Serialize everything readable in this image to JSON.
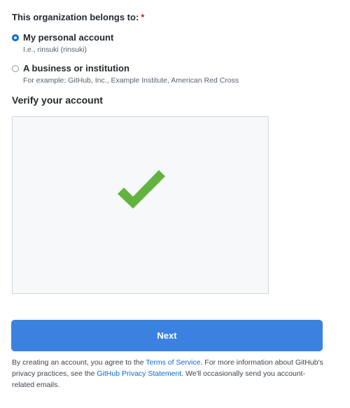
{
  "org_owner": {
    "label": "This organization belongs to:",
    "required_marker": "*",
    "options": [
      {
        "title": "My personal account",
        "note": "I.e., rinsuki (rinsuki)",
        "selected": true
      },
      {
        "title": "A business or institution",
        "note": "For example: GitHub, Inc., Example Institute, American Red Cross",
        "selected": false
      }
    ]
  },
  "verify": {
    "title": "Verify your account",
    "status_icon": "checkmark-icon",
    "check_color": "#62b23e"
  },
  "actions": {
    "next_label": "Next",
    "next_color": "#3b82e0"
  },
  "legal": {
    "text_before": "By creating an account, you agree to the ",
    "terms_link": "Terms of Service",
    "text_middle": ". For more information about GitHub's privacy practices, see the ",
    "privacy_link": "GitHub Privacy Statement",
    "text_after": ". We'll occasionally send you account-related emails."
  }
}
